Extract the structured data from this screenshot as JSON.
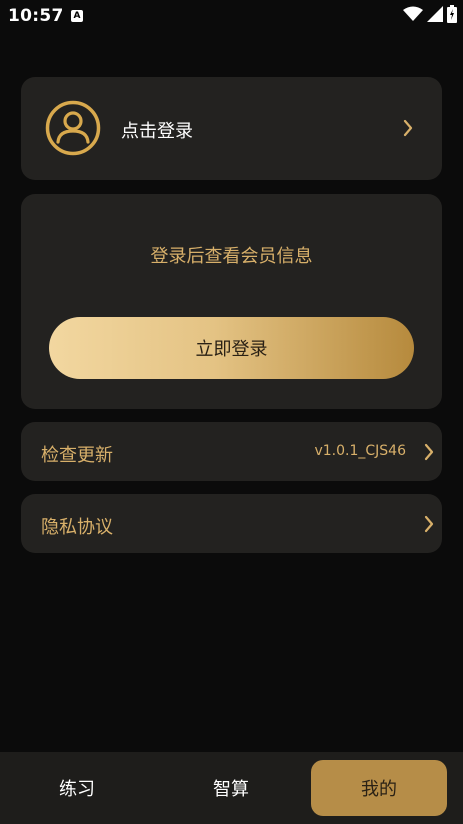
{
  "status_bar": {
    "time": "10:57",
    "notification_icon": "a-badge-icon",
    "icons": [
      "wifi-icon",
      "signal-icon",
      "battery-icon"
    ]
  },
  "login_card": {
    "avatar_icon": "user-circle-icon",
    "label": "点击登录",
    "chevron_icon": "chevron-right-icon"
  },
  "member_card": {
    "info_text": "登录后查看会员信息",
    "login_button_label": "立即登录"
  },
  "settings": {
    "check_update": {
      "label": "检查更新",
      "version": "v1.0.1_CJS46"
    },
    "privacy": {
      "label": "隐私协议"
    }
  },
  "bottom_nav": {
    "tabs": [
      {
        "label": "练习",
        "active": false
      },
      {
        "label": "智算",
        "active": false
      },
      {
        "label": "我的",
        "active": true
      }
    ]
  },
  "colors": {
    "background": "#0b0b0b",
    "card": "#232220",
    "gold_text": "#d8b06a",
    "active_tab": "#b68d48",
    "button_gradient": [
      "#f2d7a0",
      "#b68a3d"
    ]
  }
}
